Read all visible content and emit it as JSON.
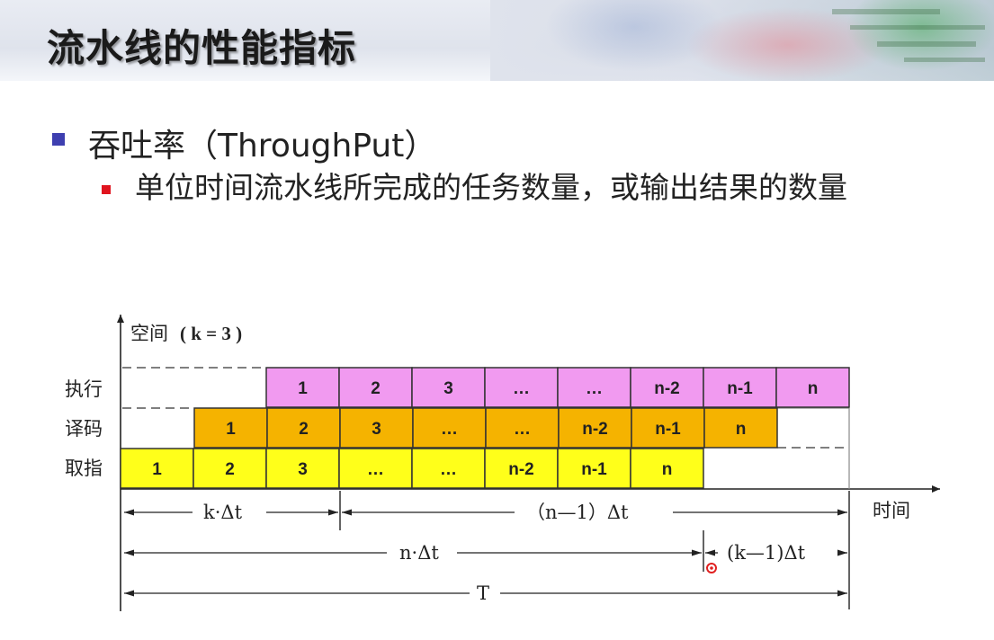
{
  "title": "流水线的性能指标",
  "bullet1": "吞吐率（ThroughPut）",
  "bullet2": "单位时间流水线所完成的任务数量，或输出结果的数量",
  "diagram": {
    "y_axis_label": "空间",
    "k_label": "( k = 3 )",
    "x_axis_label": "时间",
    "rows": [
      {
        "label": "执行",
        "color": "#f19af0",
        "cells": [
          "1",
          "2",
          "3",
          "…",
          "…",
          "n-2",
          "n-1",
          "n"
        ]
      },
      {
        "label": "译码",
        "color": "#f5b300",
        "cells": [
          "1",
          "2",
          "3",
          "…",
          "…",
          "n-2",
          "n-1",
          "n"
        ]
      },
      {
        "label": "取指",
        "color": "#ffff1a",
        "cells": [
          "1",
          "2",
          "3",
          "…",
          "…",
          "n-2",
          "n-1",
          "n"
        ]
      }
    ],
    "dim_k_dt": "k·Δt",
    "dim_n1_dt": "（n—1）Δt",
    "dim_n_dt": "n·Δt",
    "dim_k1_dt": "(k—1)Δt",
    "dim_T": "T"
  }
}
